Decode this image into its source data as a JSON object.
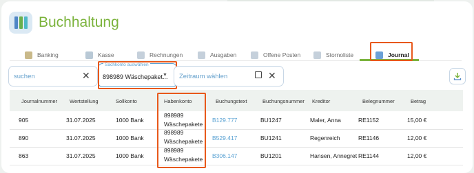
{
  "app": {
    "title": "Buchhaltung"
  },
  "tabs": [
    {
      "label": "Banking"
    },
    {
      "label": "Kasse"
    },
    {
      "label": "Rechnungen"
    },
    {
      "label": "Ausgaben"
    },
    {
      "label": "Offene Posten"
    },
    {
      "label": "Stornoliste"
    },
    {
      "label": "Journal"
    }
  ],
  "filters": {
    "search_placeholder": "suchen",
    "sachkonto_label": "Sachkonto auswählen",
    "sachkonto_value": "898989 Wäschepaket...",
    "zeitraum_placeholder": "Zeitraum wählen"
  },
  "table": {
    "headers": [
      "Journalnummer",
      "Wertstellung",
      "Sollkonto",
      "Habenkonto",
      "Buchungstext",
      "Buchungsnummer",
      "Kreditor",
      "Belegnummer",
      "Betrag"
    ],
    "rows": [
      {
        "journalnummer": "905",
        "wertstellung": "31.07.2025",
        "sollkonto": "1000 Bank",
        "habenkonto_1": "898989",
        "habenkonto_2": "Wäschepakete",
        "buchungstext": "B129.777",
        "buchungsnummer": "BU1247",
        "kreditor": "Maler, Anna",
        "belegnummer": "RE1152",
        "betrag": "15,00 €"
      },
      {
        "journalnummer": "890",
        "wertstellung": "31.07.2025",
        "sollkonto": "1000 Bank",
        "habenkonto_1": "898989",
        "habenkonto_2": "Wäschepakete",
        "buchungstext": "B529.417",
        "buchungsnummer": "BU1241",
        "kreditor": "Regenreich",
        "belegnummer": "RE1146",
        "betrag": "12,00 €"
      },
      {
        "journalnummer": "863",
        "wertstellung": "31.07.2025",
        "sollkonto": "1000 Bank",
        "habenkonto_1": "898989",
        "habenkonto_2": "Wäschepakete",
        "buchungstext": "B306.147",
        "buchungsnummer": "BU1201",
        "kreditor": "Hansen, Annegret",
        "belegnummer": "RE1144",
        "betrag": "12,00 €"
      }
    ]
  },
  "colors": {
    "accent": "#7bb33c",
    "highlight": "#e8581a",
    "link": "#5aa2d3",
    "field_border": "#c8d7e6"
  }
}
